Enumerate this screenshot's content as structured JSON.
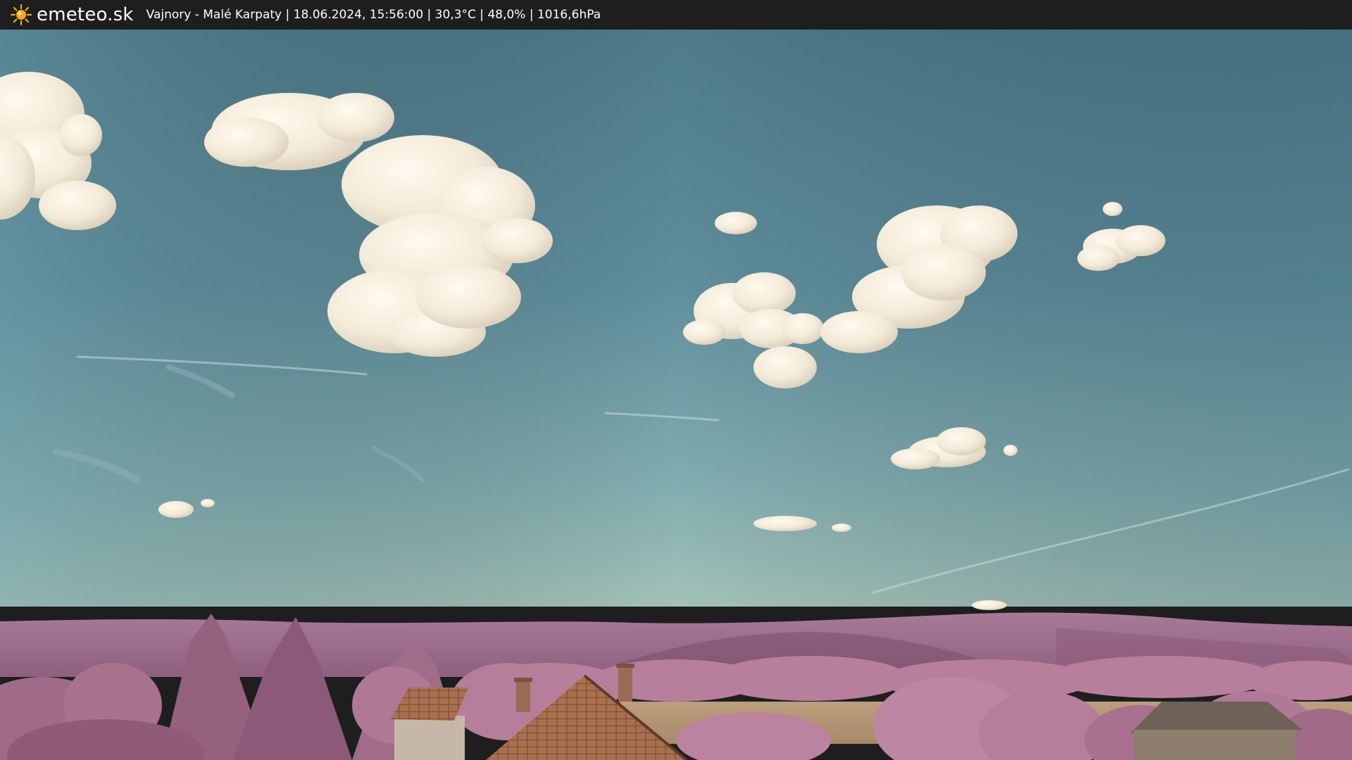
{
  "header": {
    "brand": "emeteo.sk",
    "logo_icon": "sun-icon",
    "caption": "Vajnory - Malé Karpaty | 18.06.2024, 15:56:00 | 30,3°C | 48,0% | 1016,6hPa"
  },
  "colors": {
    "bar": "#1e1e1e",
    "sky_top": "#4f7c8c",
    "sky_bottom": "#8fb5b3",
    "hills": "#a97393",
    "trees": "#b47a98",
    "field": "#b69876",
    "roof": "#a86f4e",
    "sun": "#f5a623"
  }
}
